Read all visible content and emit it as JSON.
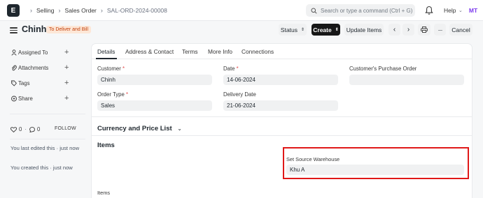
{
  "navbar": {
    "logo": "E",
    "breadcrumbs": [
      "Selling",
      "Sales Order",
      "SAL-ORD-2024-00008"
    ],
    "search_placeholder": "Search or type a command (Ctrl + G)",
    "help_label": "Help",
    "avatar_initials": "MT",
    "icons": [
      "menu-icon",
      "chevron-right-icon",
      "search-icon",
      "bell-icon",
      "chevron-down-icon"
    ]
  },
  "page": {
    "title": "Chinh",
    "status": "To Deliver and Bill",
    "buttons": {
      "status": "Status",
      "create": "Create",
      "update_items": "Update Items",
      "cancel": "Cancel"
    }
  },
  "sidebar": {
    "items": [
      {
        "label": "Assigned To",
        "icon": "user-icon"
      },
      {
        "label": "Attachments",
        "icon": "paperclip-icon"
      },
      {
        "label": "Tags",
        "icon": "tag-icon"
      },
      {
        "label": "Share",
        "icon": "share-icon"
      }
    ],
    "likes": "0",
    "comments": "0",
    "follow": "FOLLOW",
    "activity": [
      "You last edited this · just now",
      "You created this · just now"
    ]
  },
  "tabs": [
    "Details",
    "Address & Contact",
    "Terms",
    "More Info",
    "Connections"
  ],
  "form": {
    "customer_label": "Customer",
    "customer_value": "Chinh",
    "date_label": "Date",
    "date_value": "14-06-2024",
    "po_label": "Customer's Purchase Order",
    "po_value": "",
    "order_type_label": "Order Type",
    "order_type_value": "Sales",
    "delivery_label": "Delivery Date",
    "delivery_value": "21-06-2024",
    "currency_section": "Currency and Price List",
    "items_section": "Items",
    "source_wh_label": "Set Source Warehouse",
    "source_wh_value": "Khu A",
    "items_label": "Items",
    "required_mark": "*"
  },
  "colors": {
    "accent_dark": "#171717",
    "status_bg": "#fde7d7",
    "status_text": "#c2410c",
    "highlight": "#e01818",
    "avatar": "#7c3aed"
  }
}
